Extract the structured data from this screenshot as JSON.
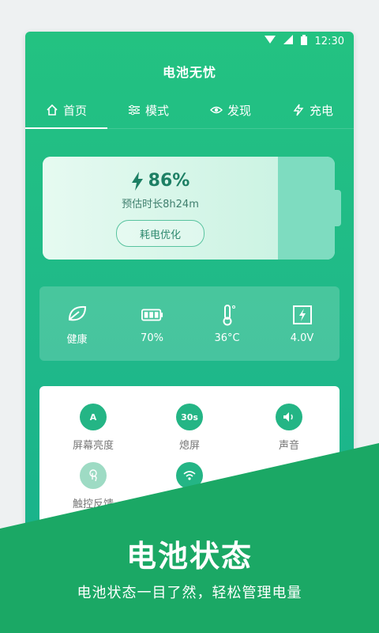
{
  "statusbar": {
    "time": "12:30"
  },
  "app": {
    "title": "电池无忧"
  },
  "tabs": [
    {
      "label": "首页",
      "icon": "home-icon"
    },
    {
      "label": "模式",
      "icon": "sliders-icon"
    },
    {
      "label": "发现",
      "icon": "eye-icon"
    },
    {
      "label": "充电",
      "icon": "bolt-icon"
    }
  ],
  "battery": {
    "percent": "86%",
    "level": 0.86,
    "estimate": "预估时长8h24m",
    "optimize_label": "耗电优化"
  },
  "stats": [
    {
      "label": "健康",
      "icon": "leaf-icon"
    },
    {
      "label": "70%",
      "icon": "battery-icon"
    },
    {
      "label": "36°C",
      "icon": "thermometer-icon"
    },
    {
      "label": "4.0V",
      "icon": "voltage-icon"
    }
  ],
  "toggles": [
    {
      "label": "屏幕亮度",
      "icon": "brightness-icon",
      "badge": "A"
    },
    {
      "label": "熄屏",
      "icon": "screen-timeout-icon",
      "badge": "30s"
    },
    {
      "label": "声音",
      "icon": "volume-icon"
    },
    {
      "label": "触控反馈",
      "icon": "touch-icon"
    },
    {
      "label": "",
      "icon": "wifi-icon"
    }
  ],
  "promo": {
    "title": "电池状态",
    "subtitle": "电池状态一目了然，轻松管理电量"
  },
  "colors": {
    "brand": "#23c281",
    "banner": "#1ba865"
  }
}
